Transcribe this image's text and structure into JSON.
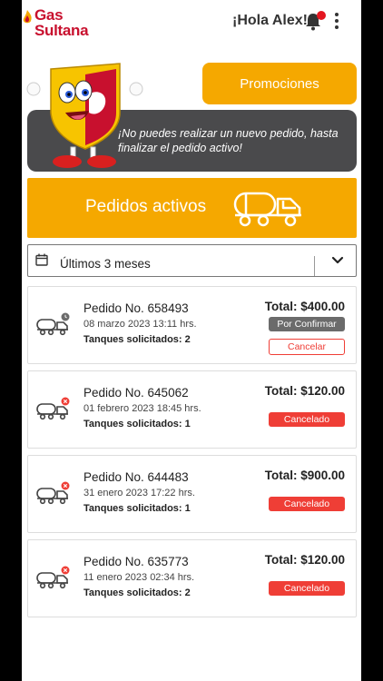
{
  "header": {
    "brand_line1": "Gas",
    "brand_line2": "Sultana",
    "greeting": "¡Hola Alex!"
  },
  "promo_button": "Promociones",
  "alert": "¡No puedes realizar un nuevo pedido, hasta finalizar el pedido activo!",
  "active_orders": {
    "title": "Pedidos activos"
  },
  "filter": {
    "label": "Últimos 3 meses"
  },
  "orders": [
    {
      "number": "Pedido No. 658493",
      "date": "08 marzo 2023 13:11 hrs.",
      "tanks": "Tanques solicitados: 2",
      "total": "Total: $400.00",
      "status": "Por Confirmar",
      "action": "Cancelar",
      "badge": "clock"
    },
    {
      "number": "Pedido No. 645062",
      "date": "01 febrero 2023 18:45 hrs.",
      "tanks": "Tanques solicitados: 1",
      "total": "Total: $120.00",
      "status": "Cancelado",
      "badge": "x"
    },
    {
      "number": "Pedido No. 644483",
      "date": "31 enero 2023 17:22 hrs.",
      "tanks": "Tanques solicitados: 1",
      "total": "Total: $900.00",
      "status": "Cancelado",
      "badge": "x"
    },
    {
      "number": "Pedido No. 635773",
      "date": "11 enero 2023 02:34 hrs.",
      "tanks": "Tanques solicitados: 2",
      "total": "Total: $120.00",
      "status": "Cancelado",
      "badge": "x"
    }
  ],
  "colors": {
    "brand_red": "#c8102e",
    "accent_yellow": "#f5a800",
    "banner_grey": "#4a4a4c",
    "status_red": "#ef3e36"
  }
}
